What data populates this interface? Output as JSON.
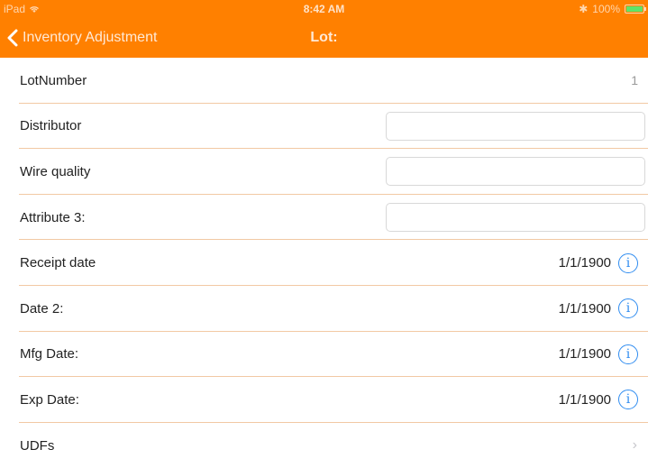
{
  "status_bar": {
    "device": "iPad",
    "time": "8:42 AM",
    "battery": "100%"
  },
  "nav": {
    "back_label": "Inventory Adjustment",
    "title": "Lot:"
  },
  "rows": {
    "lot_number": {
      "label": "LotNumber",
      "value": "1"
    },
    "distributor": {
      "label": "Distributor",
      "value": ""
    },
    "wire_quality": {
      "label": "Wire quality",
      "value": ""
    },
    "attribute3": {
      "label": "Attribute 3:",
      "value": ""
    },
    "receipt_date": {
      "label": "Receipt date",
      "value": "1/1/1900"
    },
    "date2": {
      "label": "Date 2:",
      "value": "1/1/1900"
    },
    "mfg_date": {
      "label": "Mfg Date:",
      "value": "1/1/1900"
    },
    "exp_date": {
      "label": "Exp Date:",
      "value": "1/1/1900"
    },
    "udfs": {
      "label": "UDFs"
    }
  },
  "colors": {
    "accent": "#ff8000",
    "info_blue": "#2f8cf0",
    "separator": "#f2c9a4"
  },
  "icons": {
    "back": "chevron-left-icon",
    "info": "info-circle-icon",
    "disclosure": "chevron-right-icon"
  }
}
